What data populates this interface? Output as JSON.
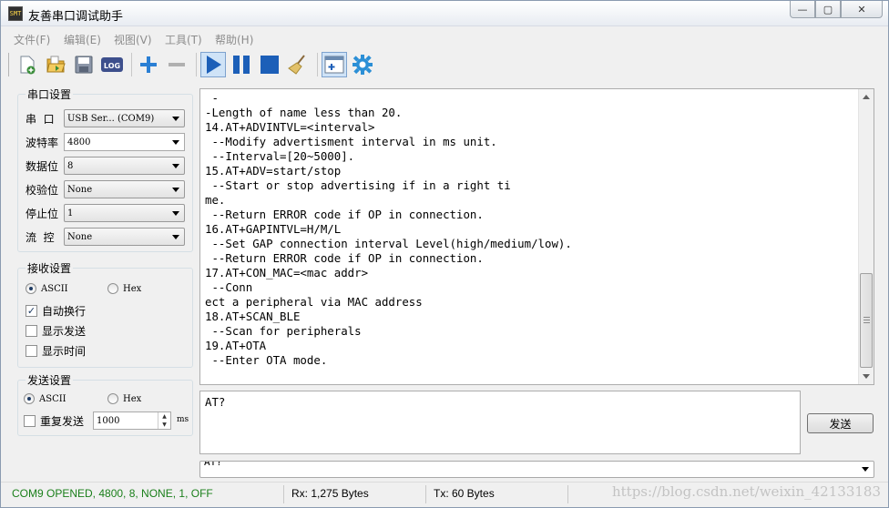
{
  "window": {
    "title": "友善串口调试助手",
    "app_icon_text": "SMT",
    "minimize": "—",
    "maximize": "▢",
    "close": "✕"
  },
  "menu": [
    "文件(F)",
    "编辑(E)",
    "视图(V)",
    "工具(T)",
    "帮助(H)"
  ],
  "toolbar": {
    "icons": [
      "new-file-icon",
      "open-folder-icon",
      "save-icon",
      "log-icon",
      "plus-icon",
      "minus-icon",
      "play-icon",
      "pause-icon",
      "stop-icon",
      "broom-icon",
      "new-window-icon",
      "gear-icon"
    ],
    "log_label": "LOG"
  },
  "serial_settings": {
    "title": "串口设置",
    "port": {
      "label": "串  口",
      "value": "USB Ser... (COM9)"
    },
    "baud": {
      "label": "波特率",
      "value": "4800"
    },
    "data_bits": {
      "label": "数据位",
      "value": "8"
    },
    "parity": {
      "label": "校验位",
      "value": "None"
    },
    "stop_bits": {
      "label": "停止位",
      "value": "1"
    },
    "flow": {
      "label": "流  控",
      "value": "None"
    }
  },
  "receive_settings": {
    "title": "接收设置",
    "ascii": "ASCII",
    "hex": "Hex",
    "auto_wrap": "自动换行",
    "show_send": "显示发送",
    "show_time": "显示时间"
  },
  "send_settings": {
    "title": "发送设置",
    "ascii": "ASCII",
    "hex": "Hex",
    "repeat": "重复发送",
    "interval": "1000",
    "unit": "ms"
  },
  "receive": {
    "lines": [
      " -",
      "-Length of name less than 20.",
      "14.AT+ADVINTVL=<interval>",
      " --Modify advertisment interval in ms unit.",
      " --Interval=[20~5000].",
      "15.AT+ADV=start/stop",
      " --Start or stop advertising if in a right ti",
      "me.",
      " --Return ERROR code if OP in connection.",
      "16.AT+GAPINTVL=H/M/L",
      " --Set GAP connection interval Level(high/medium/low).",
      " --Return ERROR code if OP in connection.",
      "17.AT+CON_MAC=<mac addr>",
      " --Conn",
      "ect a peripheral via MAC address",
      "18.AT+SCAN_BLE",
      " --Scan for peripherals",
      "19.AT+OTA",
      " --Enter OTA mode."
    ]
  },
  "send": {
    "text": "AT?",
    "button": "发送",
    "history": "AT?"
  },
  "status": {
    "port": "COM9 OPENED, 4800, 8, NONE, 1, OFF",
    "rx": "Rx: 1,275 Bytes",
    "tx": "Tx: 60 Bytes",
    "watermark": "https://blog.csdn.net/weixin_42133183"
  },
  "colors": {
    "status_green": "#1a7f1a",
    "accent_blue": "#1c5fb8"
  }
}
